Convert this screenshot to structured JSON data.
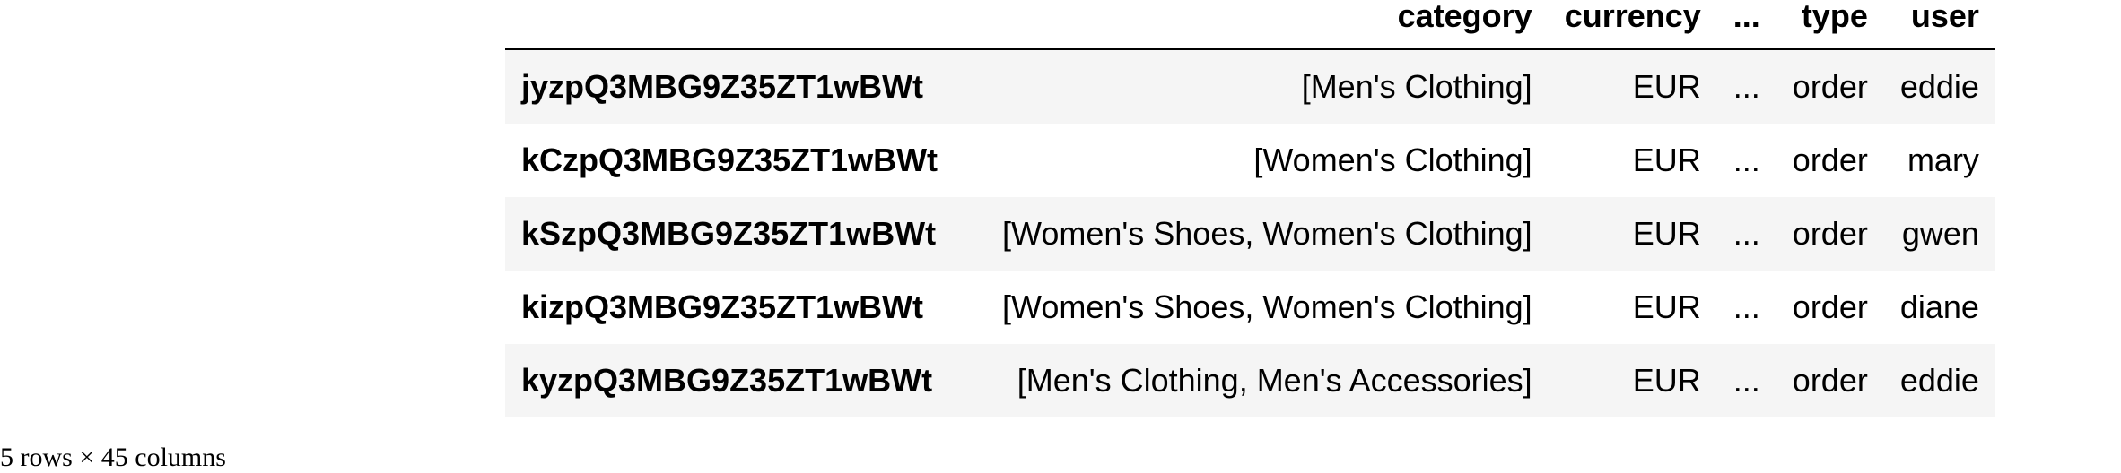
{
  "table": {
    "columns": [
      "category",
      "currency",
      "...",
      "type",
      "user"
    ],
    "rows": [
      {
        "index": "jyzpQ3MBG9Z35ZT1wBWt",
        "cells": [
          "[Men's Clothing]",
          "EUR",
          "...",
          "order",
          "eddie"
        ]
      },
      {
        "index": "kCzpQ3MBG9Z35ZT1wBWt",
        "cells": [
          "[Women's Clothing]",
          "EUR",
          "...",
          "order",
          "mary"
        ]
      },
      {
        "index": "kSzpQ3MBG9Z35ZT1wBWt",
        "cells": [
          "[Women's Shoes, Women's Clothing]",
          "EUR",
          "...",
          "order",
          "gwen"
        ]
      },
      {
        "index": "kizpQ3MBG9Z35ZT1wBWt",
        "cells": [
          "[Women's Shoes, Women's Clothing]",
          "EUR",
          "...",
          "order",
          "diane"
        ]
      },
      {
        "index": "kyzpQ3MBG9Z35ZT1wBWt",
        "cells": [
          "[Men's Clothing, Men's Accessories]",
          "EUR",
          "...",
          "order",
          "eddie"
        ]
      }
    ]
  },
  "shape_note": "5 rows × 45 columns"
}
